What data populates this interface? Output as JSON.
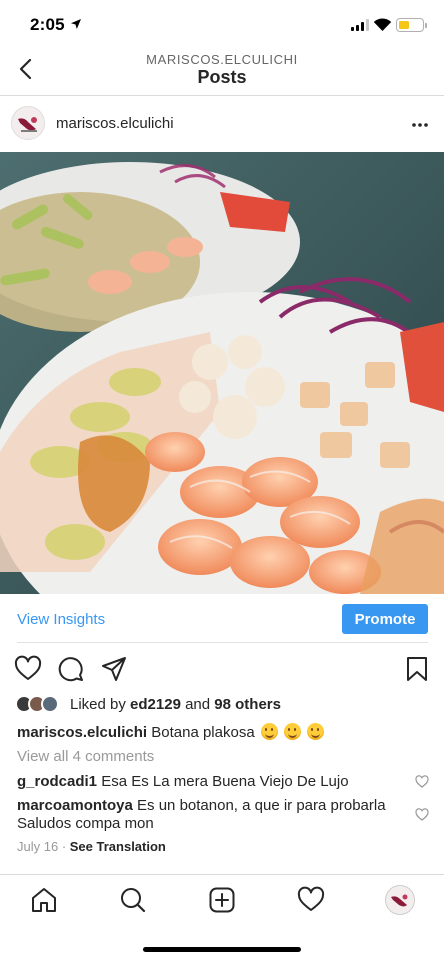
{
  "status_bar": {
    "time": "2:05"
  },
  "header": {
    "account": "MARISCOS.ELCULICHI",
    "title": "Posts"
  },
  "post": {
    "username": "mariscos.elculichi",
    "image_alt": "Botana plakosa seafood platter",
    "insights_label": "View Insights",
    "promote_label": "Promote",
    "likes": {
      "prefix": "Liked by ",
      "user": "ed2129",
      "middle": " and ",
      "count_text": "98 others"
    },
    "caption": {
      "username": "mariscos.elculichi",
      "text": "Botana plakosa"
    },
    "view_all_comments": "View all 4 comments",
    "comments": [
      {
        "username": "g_rodcadi1",
        "text": "Esa Es La mera Buena Viejo De Lujo"
      },
      {
        "username": "marcoamontoya",
        "text": "Es un botanon,  a que ir para probarla Saludos compa mon"
      }
    ],
    "date": "July 16",
    "separator": " · ",
    "see_translation": "See Translation"
  },
  "colors": {
    "accent": "#3897f0",
    "text": "#262626",
    "muted": "#999999",
    "divider": "#dbdbdb"
  },
  "icons": {
    "back": "chevron-left-icon",
    "more": "more-horizontal-icon",
    "like": "heart-icon",
    "comment": "comment-icon",
    "share": "send-icon",
    "save": "bookmark-icon",
    "tabs": [
      "home-icon",
      "search-icon",
      "add-post-icon",
      "activity-heart-icon",
      "profile-avatar"
    ]
  }
}
